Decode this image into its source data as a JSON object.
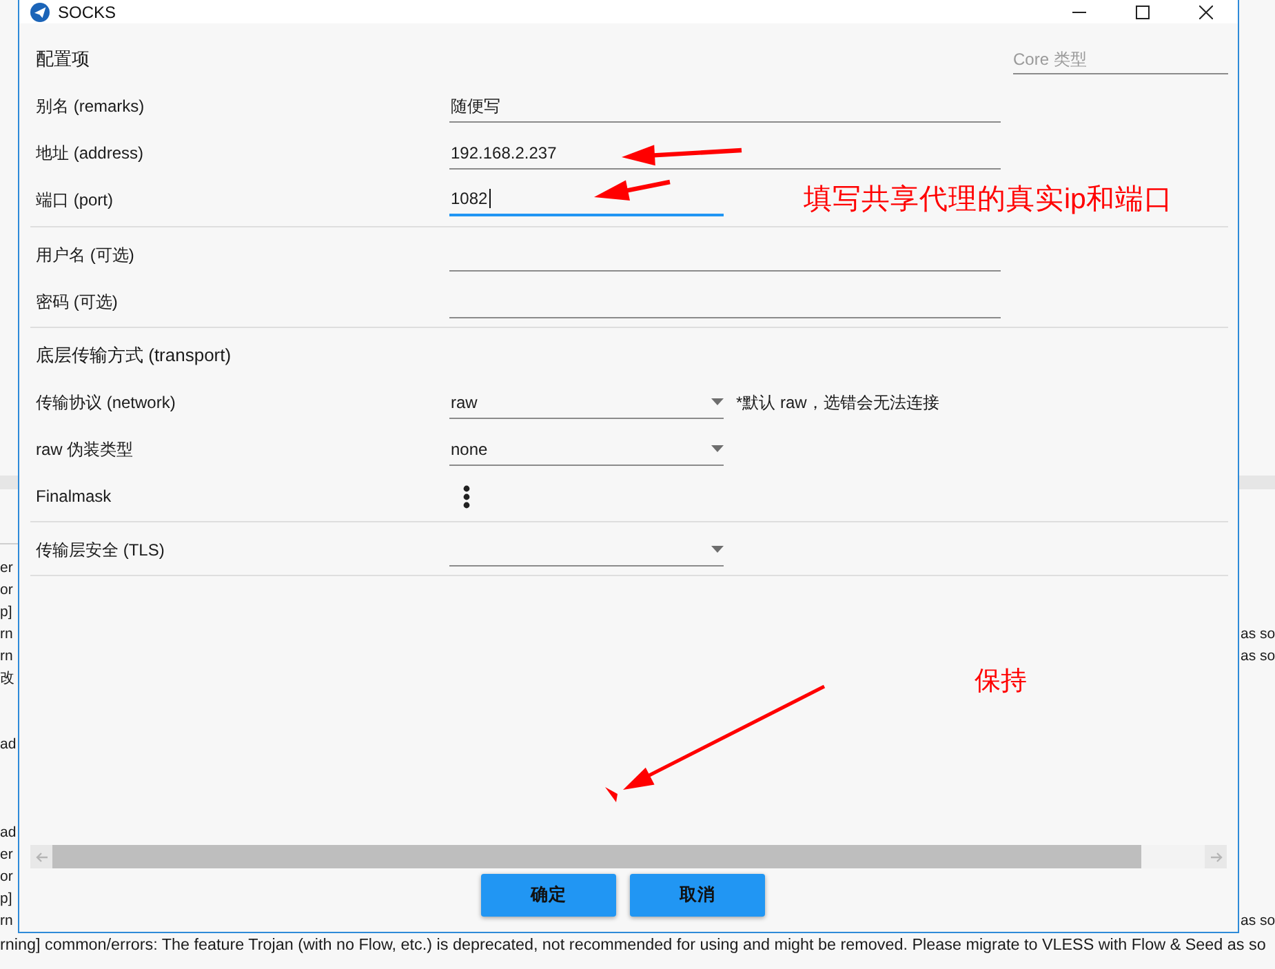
{
  "window": {
    "title": "SOCKS"
  },
  "sections": [
    {
      "rows": [
        {
          "kind": "heading",
          "label": "配置项",
          "field": {
            "placeholder": "Core 类型"
          }
        },
        {
          "kind": "text",
          "label": "别名 (remarks)",
          "value": "随便写",
          "focused": false
        },
        {
          "kind": "text",
          "label": "地址 (address)",
          "value": "192.168.2.237",
          "focused": false
        },
        {
          "kind": "number",
          "label": "端口 (port)",
          "value": "1082",
          "focused": true
        }
      ]
    },
    {
      "rows": [
        {
          "kind": "text",
          "label": "用户名 (可选)",
          "focused": false
        },
        {
          "kind": "text",
          "label": "密码 (可选)",
          "focused": false
        }
      ]
    },
    {
      "rows": [
        {
          "kind": "heading",
          "label": "底层传输方式 (transport)"
        },
        {
          "kind": "select",
          "label": "传输协议 (network)",
          "value": "raw",
          "note": "*默认 raw，选错会无法连接"
        },
        {
          "kind": "select",
          "label": "raw 伪装类型",
          "value": "none"
        },
        {
          "kind": "menu",
          "label": "Finalmask"
        }
      ]
    },
    {
      "rows": [
        {
          "kind": "select",
          "label": "传输层安全 (TLS)"
        }
      ]
    }
  ],
  "buttons": [
    "确定",
    "取消"
  ],
  "annotations": [
    {
      "text": "填写共享代理的真实ip和端口"
    },
    {
      "text": "保持"
    }
  ],
  "background_log": {
    "groups": [
      {
        "lines": [
          {
            "left": "er"
          },
          {
            "left": "or"
          },
          {
            "left": "p]"
          },
          {
            "left": "rn",
            "right": "as so"
          },
          {
            "left": "rn",
            "right": "as so"
          },
          {
            "left": "改"
          }
        ]
      },
      {
        "lines": [
          {
            "left": "ad"
          }
        ]
      },
      {
        "lines": [
          {
            "left": "ad"
          },
          {
            "left": "er"
          },
          {
            "left": "or"
          },
          {
            "left": "p]"
          },
          {
            "left": "rn",
            "right": "as so"
          }
        ]
      }
    ],
    "last_line": "rning] common/errors: The feature Trojan (with no Flow, etc.) is deprecated, not recommended for using and might be removed. Please migrate to VLESS with Flow & Seed as so"
  }
}
